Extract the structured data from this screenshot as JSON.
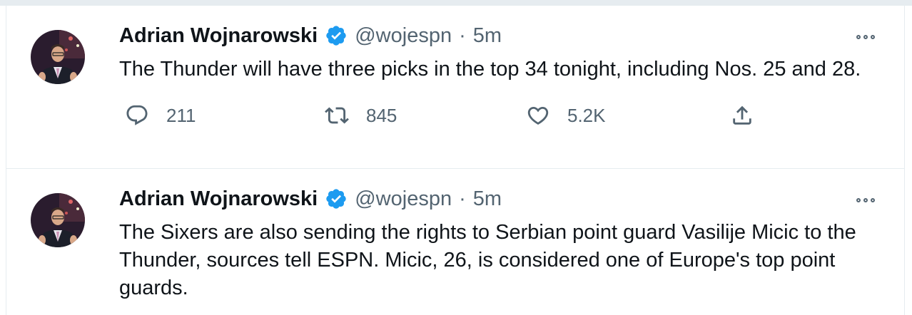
{
  "tweets": [
    {
      "author_name": "Adrian Wojnarowski",
      "handle": "@wojespn",
      "separator": "·",
      "timestamp": "5m",
      "text": "The Thunder will have three picks in the top 34 tonight, including Nos. 25 and 28.",
      "replies": "211",
      "retweets": "845",
      "likes": "5.2K"
    },
    {
      "author_name": "Adrian Wojnarowski",
      "handle": "@wojespn",
      "separator": "·",
      "timestamp": "5m",
      "text": "The Sixers are also sending the rights to Serbian point guard Vasilije Micic to the Thunder, sources tell ESPN. Micic, 26, is considered one of Europe's top point guards."
    }
  ],
  "icons": {
    "verified": "verified-badge-icon",
    "more": "more-options-icon",
    "reply": "reply-icon",
    "retweet": "retweet-icon",
    "like": "like-icon",
    "share": "share-icon"
  },
  "colors": {
    "verified_blue": "#1d9bf0",
    "text_primary": "#0f1419",
    "text_secondary": "#536471",
    "divider": "#e6ecf0"
  }
}
